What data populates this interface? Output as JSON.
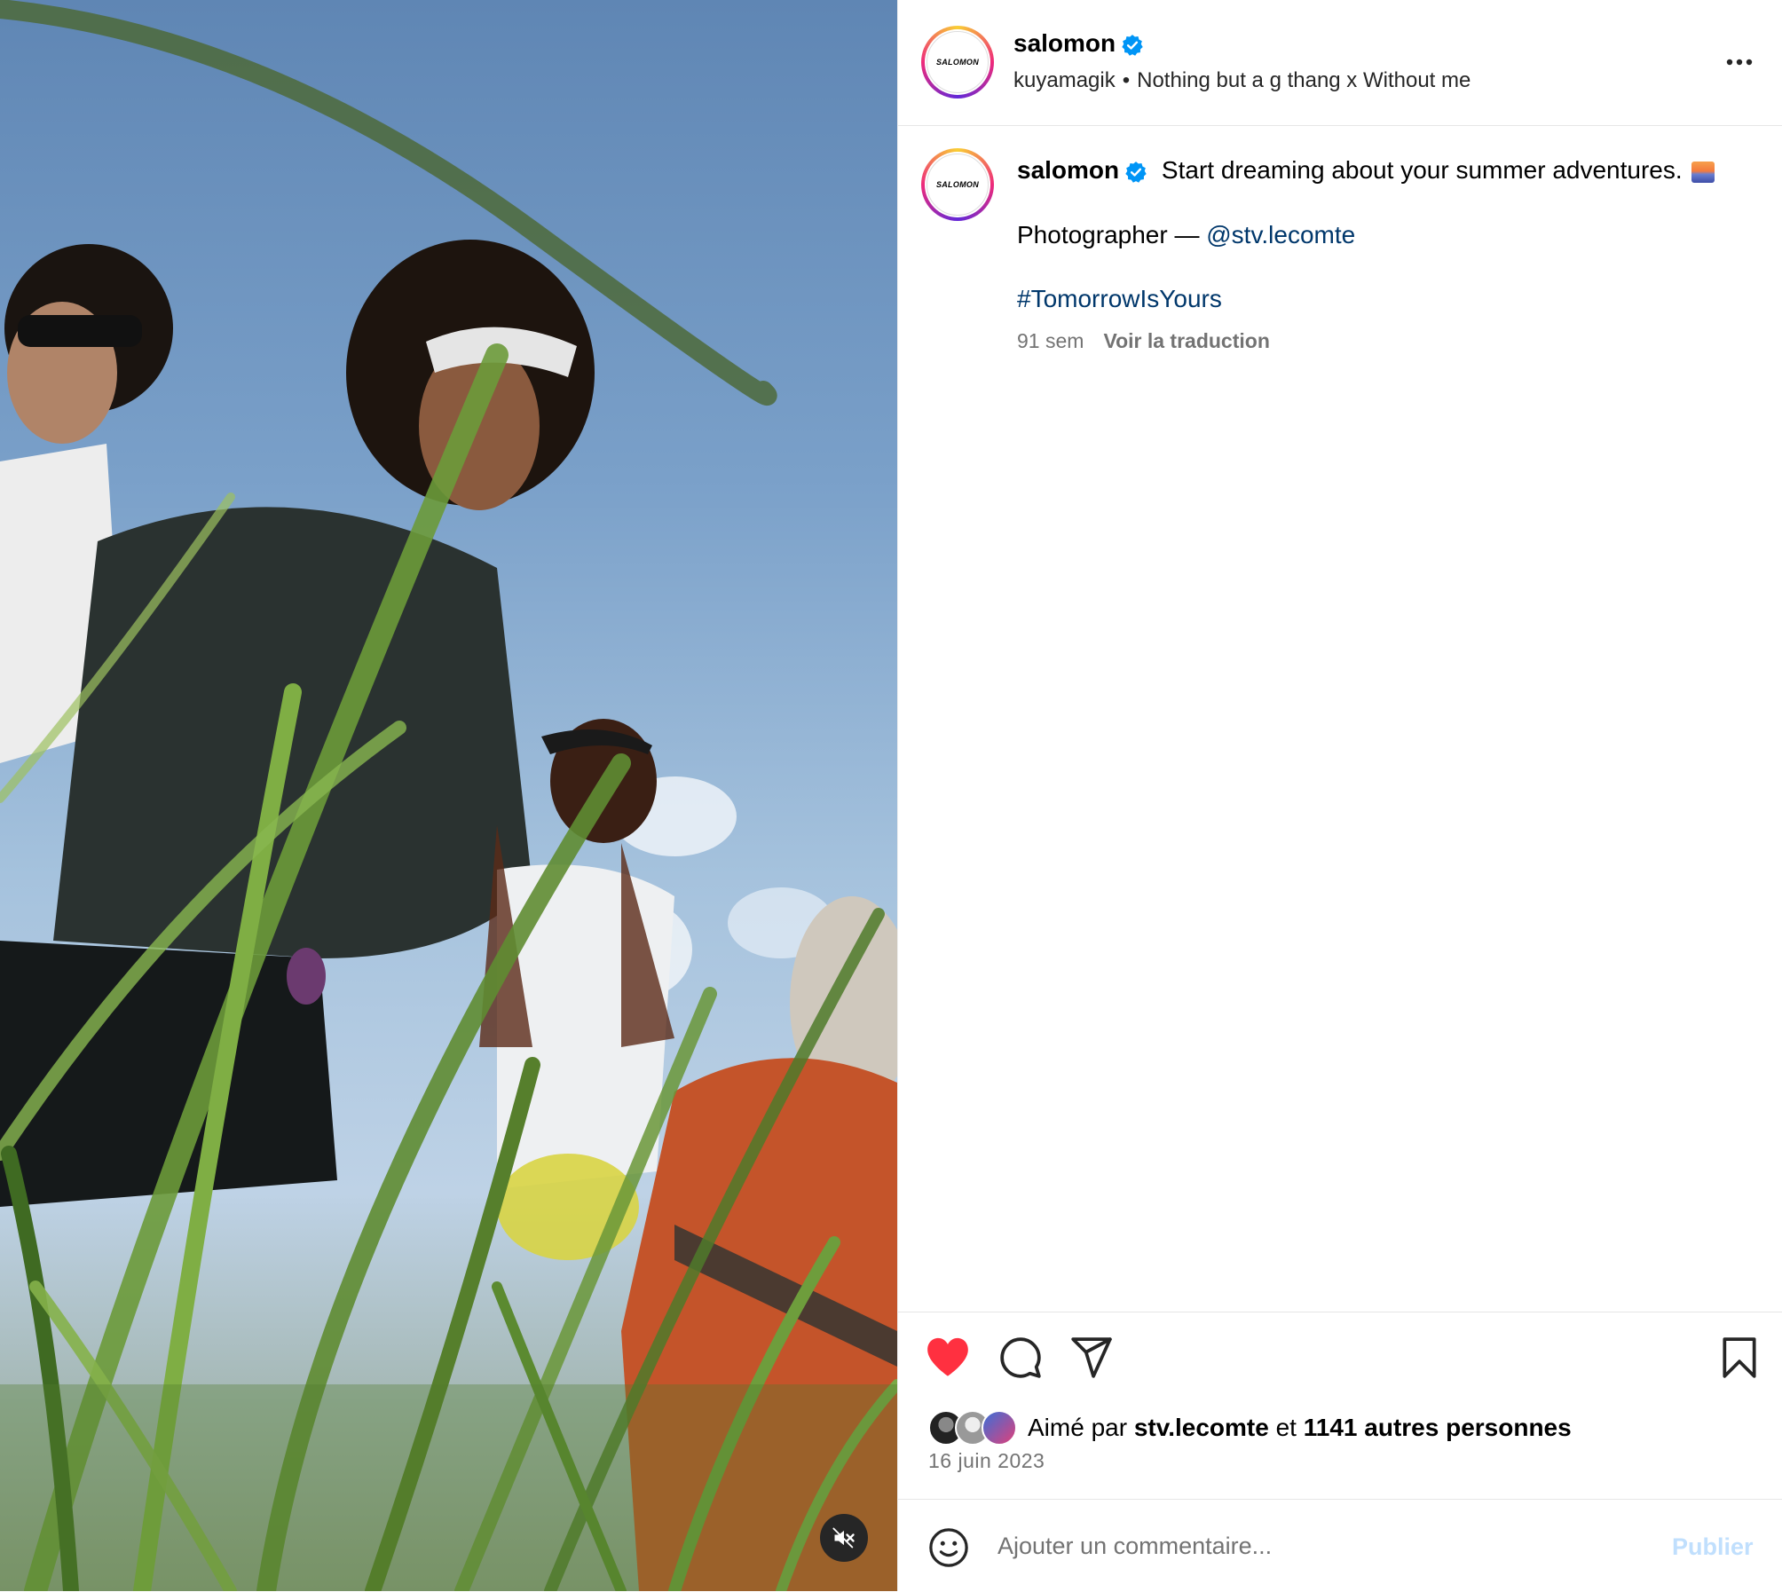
{
  "post": {
    "media": {
      "alt_description": "",
      "mute_icon": "speaker-muted-icon"
    },
    "header": {
      "username": "salomon",
      "avatar_text": "SALOMON",
      "audio_artist": "kuyamagik",
      "separator": "•",
      "audio_track": "Nothing but a g thang x Without me",
      "more_icon": "more-dots-icon"
    },
    "caption": {
      "username": "salomon",
      "avatar_text": "SALOMON",
      "text": "Start dreaming about your summer adventures.",
      "emoji_icon": "sunrise-emoji-icon",
      "photographer_label": "Photographer —",
      "photographer_handle": "@stv.lecomte",
      "hashtag": "#TomorrowIsYours",
      "age": "91 sem",
      "translate_label": "Voir la traduction"
    },
    "actions": {
      "like_icon": "heart-filled-icon",
      "comment_icon": "comment-bubble-icon",
      "share_icon": "paper-plane-icon",
      "save_icon": "bookmark-icon",
      "liked_state": true,
      "like_color": "#ff3040"
    },
    "likes": {
      "prefix": "Aimé par",
      "user": "stv.lecomte",
      "connector": "et",
      "others": "1141 autres personnes"
    },
    "date": "16 juin 2023",
    "comment_box": {
      "placeholder": "Ajouter un commentaire...",
      "value": "",
      "publish_label": "Publier",
      "emoji_icon": "smiley-icon"
    }
  },
  "colors": {
    "link": "#00376b",
    "verified": "#0095f6",
    "muted_text": "#737373",
    "publish_disabled": "#c0dffd"
  }
}
